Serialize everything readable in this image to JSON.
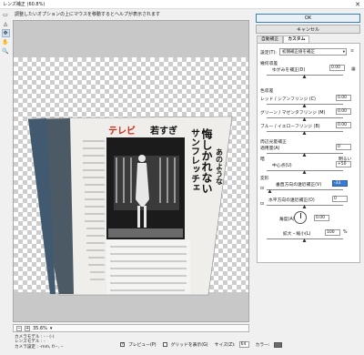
{
  "window": {
    "title": "レンズ補正 (60.8%)",
    "close": "✕"
  },
  "hint_text": "調整したいオプションの上にマウスを移動するとヘルプが表示されます",
  "tools": [
    {
      "icon": "distortion-tool-icon",
      "glyph": "▭"
    },
    {
      "icon": "straighten-tool-icon",
      "glyph": "◬"
    },
    {
      "icon": "move-grid-tool-icon",
      "glyph": "✥"
    },
    {
      "icon": "hand-tool-icon",
      "glyph": "✋"
    },
    {
      "icon": "zoom-tool-icon",
      "glyph": "🔍"
    }
  ],
  "buttons": {
    "ok": "OK",
    "cancel": "キャンセル"
  },
  "tabs": {
    "auto": "自動補正",
    "custom": "カスタム"
  },
  "settings": {
    "label": "設定(T):",
    "value": "初期補正値を補正",
    "menu_icon": "≡"
  },
  "geometric": {
    "title": "幾何収差",
    "distortion_label": "ゆがみを補正(D)",
    "distortion_value": "0.00"
  },
  "chromatic": {
    "title": "色収差",
    "red_cyan_label": "レッド / シアンフリンジ (C)",
    "red_cyan_value": "0.00",
    "green_magenta_label": "グリーン / マゼンタフリンジ (M)",
    "green_magenta_value": "0.00",
    "blue_yellow_label": "ブルー / イエローフリンジ (B)",
    "blue_yellow_value": "0.00"
  },
  "vignette": {
    "title": "周辺光量補正",
    "amount_label": "適用量(A)",
    "amount_value": "0",
    "dark": "暗",
    "light": "明るい",
    "midpoint_label": "中心点(U)",
    "midpoint_value": "+50"
  },
  "transform": {
    "title": "変形",
    "vertical_label": "垂直方向の遠近補正(V)",
    "vertical_value": "-33",
    "horizontal_label": "水平方向の遠近補正(O)",
    "horizontal_value": "0",
    "angle_label": "角度(A)",
    "angle_value": "0.00",
    "scale_label": "拡大・縮小(L)",
    "scale_value": "100",
    "scale_unit": "%"
  },
  "slider_levels": {
    "distortion": 0.5,
    "red_cyan": 0.5,
    "green_magenta": 0.5,
    "blue_yellow": 0.5,
    "amount": 0.5,
    "midpoint": 0.5,
    "vertical": 0.05,
    "horizontal": 0.5,
    "scale": 0.5
  },
  "zoom": {
    "minus": "−",
    "plus": "+",
    "value": "35.6%"
  },
  "camera_info": {
    "model": "カメラモデル : - - (-)",
    "lens": "レンズモデル : -",
    "settings": "カメラ設定 : -mm, f/--, --"
  },
  "bottom": {
    "preview_label": "プレビュー(P)",
    "grid_label": "グリッドを表示(G)",
    "size_label": "サイズ(Z):",
    "size_value": "64",
    "color_label": "カラー:"
  },
  "photo": {
    "headline_1": "テレビ",
    "headline_2": "若すぎ",
    "right_title": "サンフレッチェ",
    "big_text": "悔しかれない",
    "col_text": "あのような"
  }
}
